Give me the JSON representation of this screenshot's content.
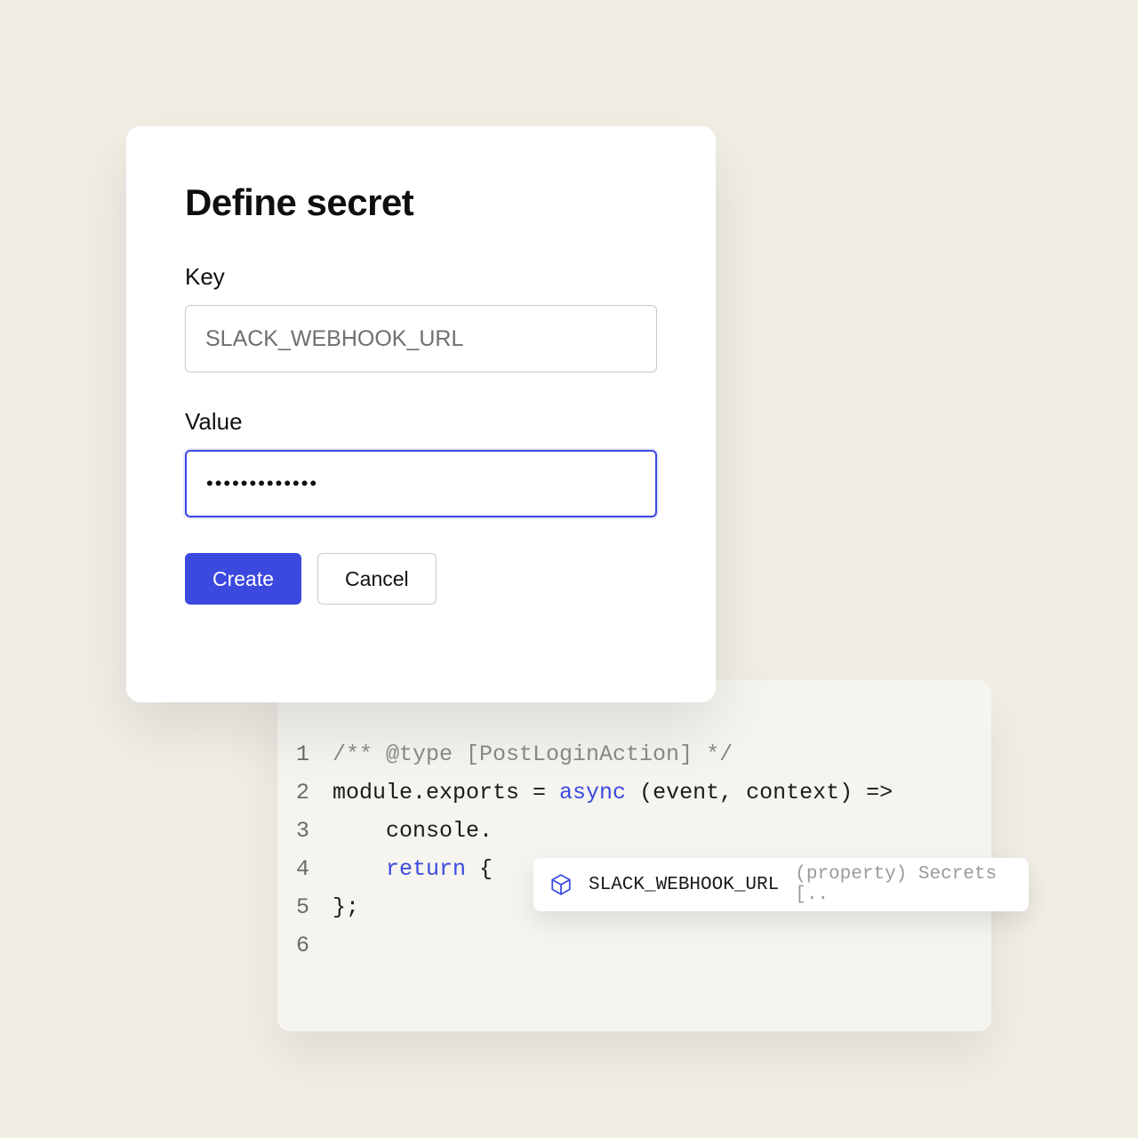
{
  "modal": {
    "title": "Define secret",
    "key_label": "Key",
    "key_value": "SLACK_WEBHOOK_URL",
    "value_label": "Value",
    "value_value": "•••••••••••••",
    "create_label": "Create",
    "cancel_label": "Cancel"
  },
  "code": {
    "lines": [
      {
        "n": "1",
        "segments": [
          {
            "cls": "tok-comment",
            "t": "/** @type [PostLoginAction] */"
          }
        ]
      },
      {
        "n": "2",
        "segments": [
          {
            "cls": "tok-plain",
            "t": "module.exports = "
          },
          {
            "cls": "tok-key",
            "t": "async"
          },
          {
            "cls": "tok-plain",
            "t": " (event, context) =>"
          }
        ]
      },
      {
        "n": "3",
        "segments": [
          {
            "cls": "tok-plain",
            "t": "    console."
          }
        ]
      },
      {
        "n": "4",
        "segments": [
          {
            "cls": "tok-plain",
            "t": "    "
          },
          {
            "cls": "tok-key",
            "t": "return"
          },
          {
            "cls": "tok-plain",
            "t": " {"
          }
        ]
      },
      {
        "n": "5",
        "segments": [
          {
            "cls": "tok-plain",
            "t": "};"
          }
        ]
      },
      {
        "n": "6",
        "segments": [
          {
            "cls": "tok-plain",
            "t": ""
          }
        ]
      }
    ]
  },
  "autocomplete": {
    "icon": "cube-icon",
    "name": "SLACK_WEBHOOK_URL",
    "hint": "(property) Secrets [.."
  },
  "colors": {
    "accent": "#3b49df",
    "bg": "#f1eee6"
  }
}
